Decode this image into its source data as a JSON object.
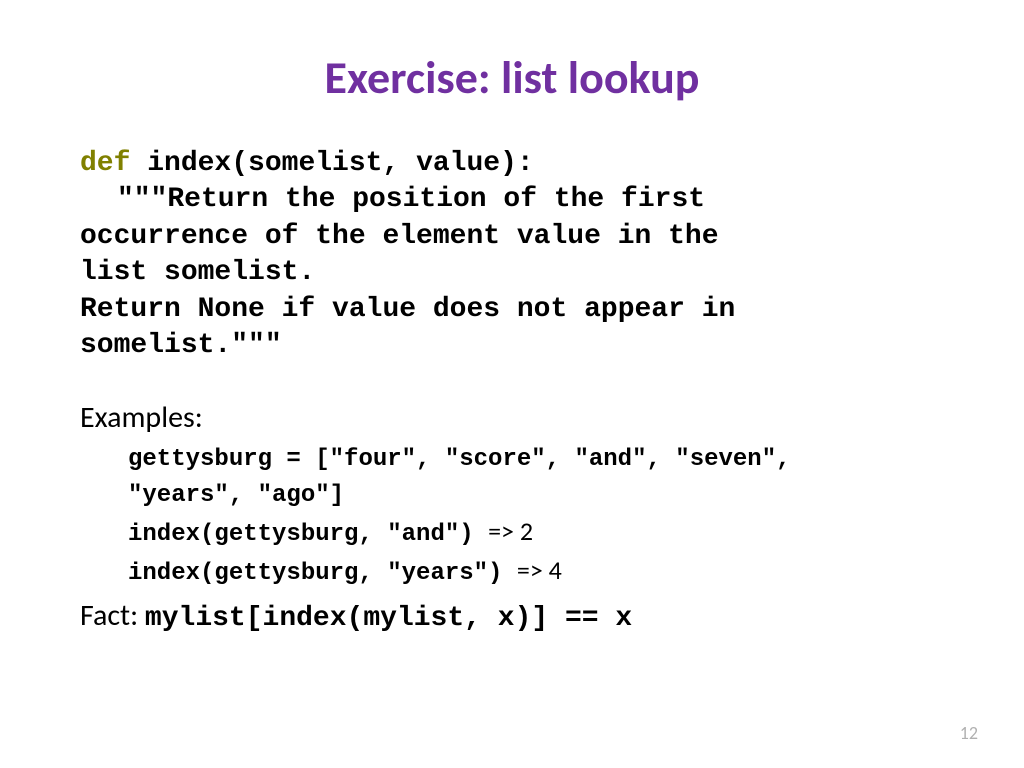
{
  "title": "Exercise:  list lookup",
  "def_keyword": "def",
  "func_signature": " index(somelist, value):",
  "docstring_line1": "\"\"\"Return the position of the first",
  "docstring_line2": "occurrence of the element value in the",
  "docstring_line3": "list somelist.",
  "docstring_line4": "Return None if value does not appear in",
  "docstring_line5": "somelist.\"\"\"",
  "examples_label": "Examples:",
  "example1a": "gettysburg = [\"four\", \"score\", \"and\", \"seven\",",
  "example1b": "\"years\", \"ago\"]",
  "example2_code": "index(gettysburg, \"and\") ",
  "example2_arrow": "=>",
  "example2_result": " 2",
  "example3_code": "index(gettysburg, \"years\") ",
  "example3_arrow": "=>",
  "example3_result": " 4",
  "fact_label": "Fact: ",
  "fact_code": "mylist[index(mylist, x)] == x",
  "page_number": "12"
}
